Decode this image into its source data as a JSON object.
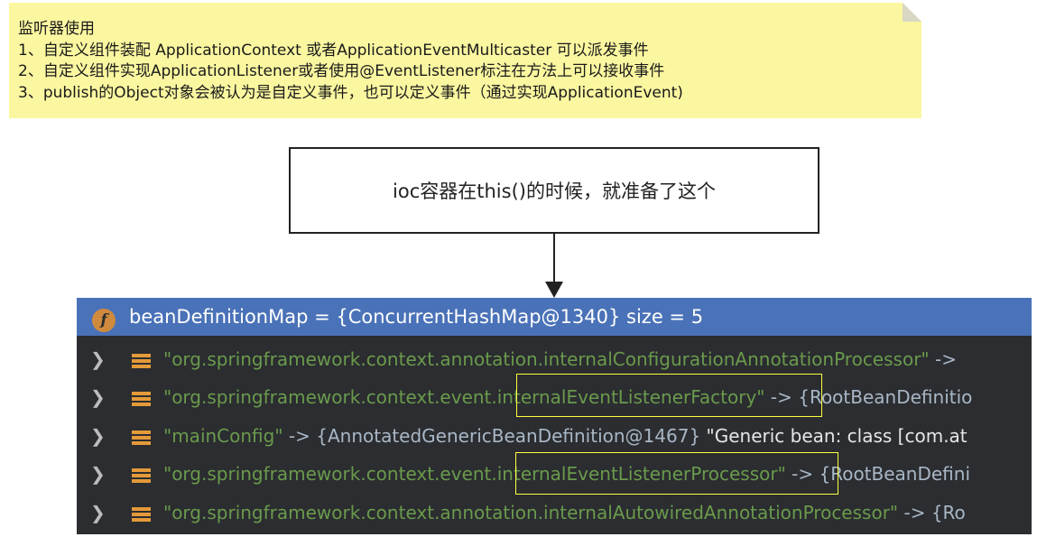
{
  "note": {
    "lines": [
      "监听器使用",
      "1、自定义组件装配 ApplicationContext 或者ApplicationEventMulticaster 可以派发事件",
      "2、自定义组件实现ApplicationListener或者使用@EventListener标注在方法上可以接收事件",
      "3、publish的Object对象会被认为是自定义事件，也可以定义事件（通过实现ApplicationEvent)"
    ]
  },
  "diagram": {
    "box_text": "ioc容器在this()的时候，就准备了这个"
  },
  "debugger": {
    "field_icon": "f",
    "header": "beanDefinitionMap = {ConcurrentHashMap@1340}  size = 5",
    "rows": [
      {
        "key": "\"org.springframework.context.annotation.internalConfigurationAnnotationProcessor\"",
        "arrow": " -> ",
        "value": "",
        "desc": ""
      },
      {
        "key": "\"org.springframework.context.event.internalEventListenerFactory\"",
        "arrow": " -> ",
        "value": "{RootBeanDefinitio",
        "desc": ""
      },
      {
        "key": "\"mainConfig\"",
        "arrow": " -> ",
        "value": "{AnnotatedGenericBeanDefinition@1467}",
        "desc": " \"Generic bean: class [com.at"
      },
      {
        "key": "\"org.springframework.context.event.internalEventListenerProcessor\"",
        "arrow": " -> ",
        "value": "{RootBeanDefini",
        "desc": ""
      },
      {
        "key": "\"org.springframework.context.annotation.internalAutowiredAnnotationProcessor\"",
        "arrow": " -> ",
        "value": "{Ro",
        "desc": ""
      }
    ]
  },
  "colors": {
    "note_bg": "#fbf7a0",
    "panel_bg": "#2b2d30",
    "selected_row": "#4a72b8",
    "string_green": "#6a9a4c",
    "highlight_box": "#ffff40"
  }
}
